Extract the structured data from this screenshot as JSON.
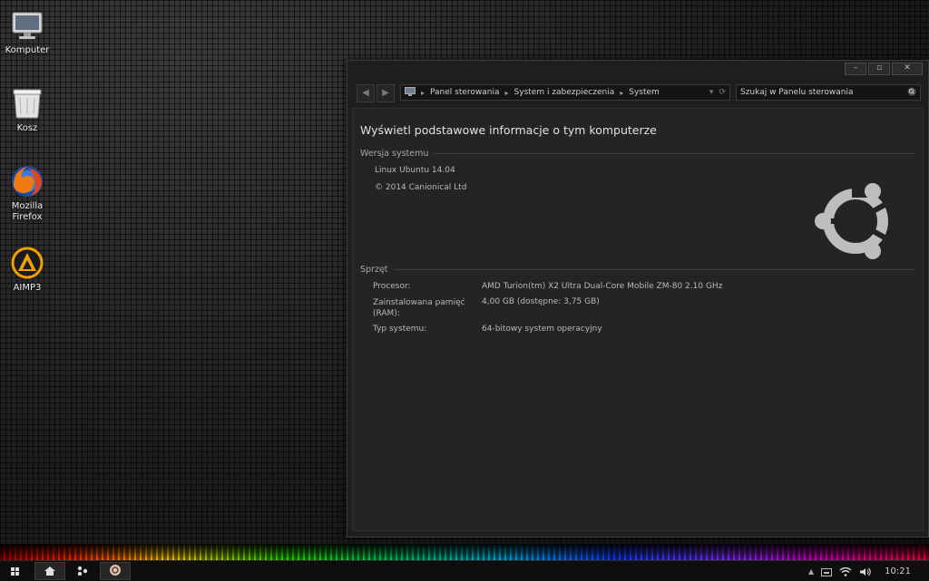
{
  "desktop": {
    "icons": [
      {
        "label": "Komputer",
        "icon": "monitor-icon"
      },
      {
        "label": "Kosz",
        "icon": "trash-icon"
      },
      {
        "label": "Mozilla Firefox",
        "icon": "firefox-icon"
      },
      {
        "label": "AIMP3",
        "icon": "aimp-icon"
      }
    ]
  },
  "window": {
    "controls": {
      "minimize": "–",
      "maximize": "▫",
      "close": "✕"
    },
    "breadcrumb": [
      "Panel sterowania",
      "System i zabezpieczenia",
      "System"
    ],
    "search_placeholder": "Szukaj w Panelu sterowania",
    "title": "Wyświetl podstawowe informacje o tym komputerze",
    "system_version": {
      "heading": "Wersja systemu",
      "os": "Linux Ubuntu 14.04",
      "copyright": "© 2014 Canionical Ltd"
    },
    "hardware": {
      "heading": "Sprzęt",
      "rows": [
        {
          "label": "Procesor:",
          "value": "AMD Turion(tm) X2 Ultra Dual-Core Mobile ZM-80   2.10 GHz"
        },
        {
          "label": "Zainstalowana pamięć (RAM):",
          "value": "4,00 GB (dostępne: 3,75 GB)"
        },
        {
          "label": "Typ systemu:",
          "value": "64-bitowy system operacyjny"
        }
      ]
    }
  },
  "taskbar": {
    "clock": "10:21"
  },
  "colors": {
    "window_bg": "#1e1e1e",
    "content_bg": "#242424",
    "text": "#b8b8b8"
  }
}
